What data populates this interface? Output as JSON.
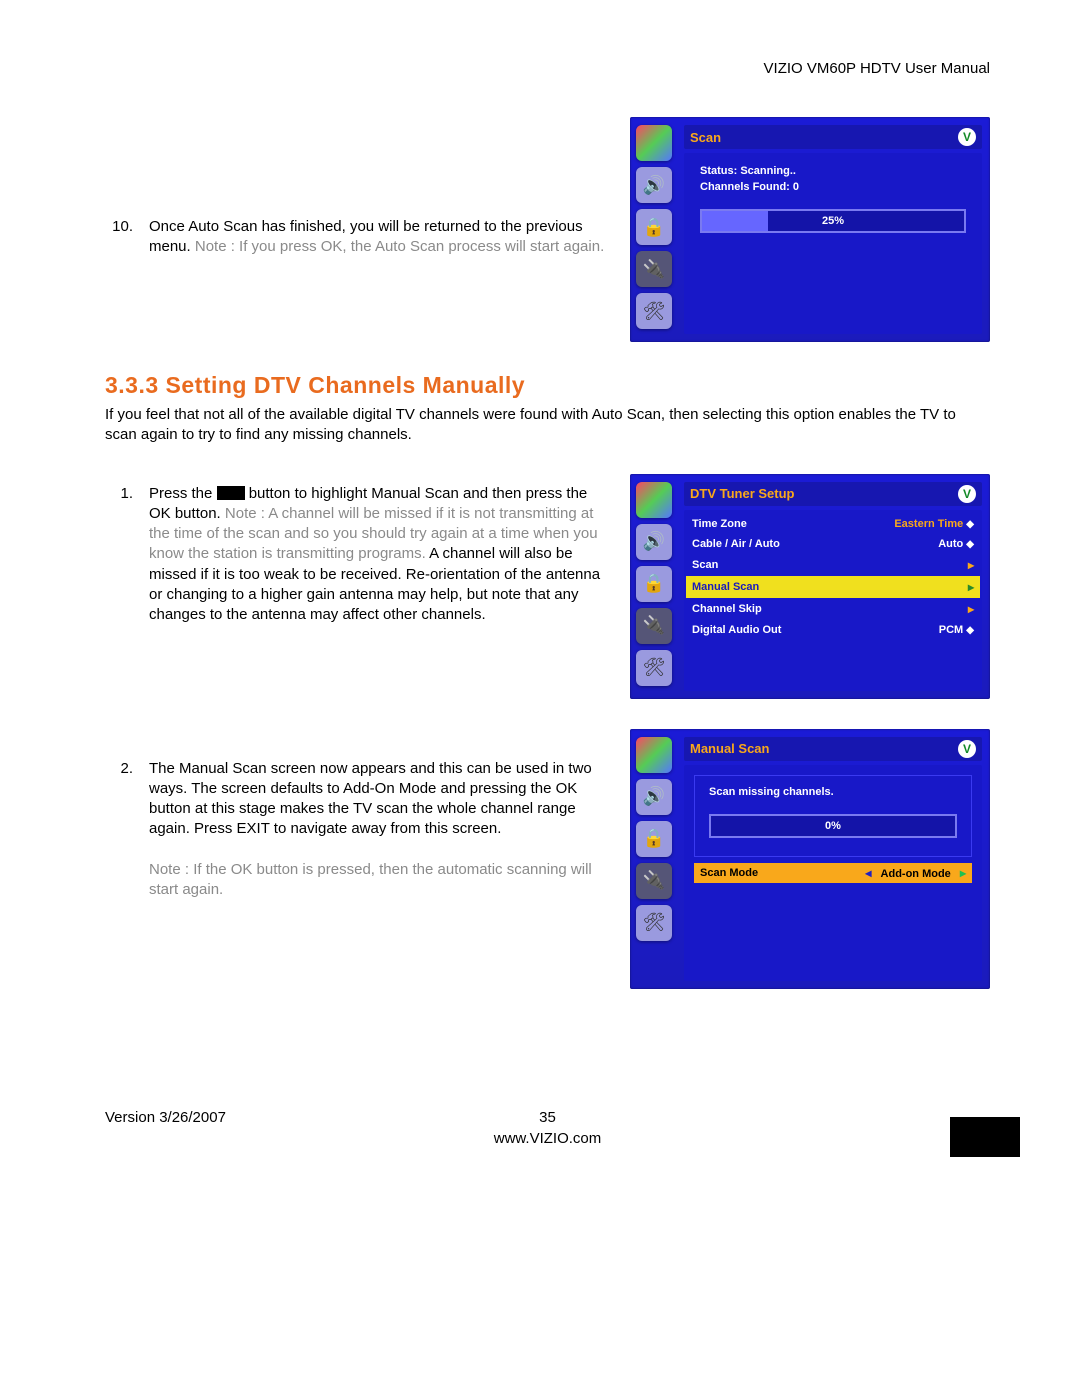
{
  "header": "VIZIO VM60P HDTV User Manual",
  "step10": {
    "num": "10.",
    "text_a": "Once Auto Scan has finished, you will be returned to the previous menu.  ",
    "note_label": "Note :",
    "note_text": " If you press OK, the Auto Scan process will start again."
  },
  "osd_scan": {
    "title": "Scan",
    "status": "Status: Scanning..",
    "found": "Channels Found: 0",
    "progress_pct": "25%",
    "progress_fill_pct": 25
  },
  "section_heading": "3.3.3 Setting DTV Channels Manually",
  "section_intro": "If you feel that not all of the available digital TV channels were found with Auto Scan, then selecting this option enables the TV to scan again to try to find any missing channels.",
  "step1": {
    "num": "1.",
    "text_a": "Press the ",
    "text_b": " button to highlight Manual Scan and then press the OK button. ",
    "note_label": "Note :",
    "note_text": " A channel will be missed if it is not transmitting at the time of the scan and so you should try again at a time when you know the station is transmitting programs.",
    "text_c": " A channel will also be missed if it is too weak to be received.  Re-orientation of the antenna or changing to a higher gain antenna may help, but note that any changes to the antenna may affect other channels."
  },
  "osd_tuner": {
    "title": "DTV Tuner Setup",
    "rows": [
      {
        "label": "Time Zone",
        "value": "Eastern Time",
        "widget": "updown"
      },
      {
        "label": "Cable / Air / Auto",
        "value": "Auto",
        "widget": "updown"
      },
      {
        "label": "Scan",
        "value": "",
        "widget": "arrow"
      },
      {
        "label": "Manual Scan",
        "value": "",
        "widget": "arrow",
        "highlight": true
      },
      {
        "label": "Channel Skip",
        "value": "",
        "widget": "arrow"
      },
      {
        "label": "Digital Audio Out",
        "value": "PCM",
        "widget": "updown"
      }
    ]
  },
  "step2": {
    "num": "2.",
    "text_a": "The Manual Scan screen now appears and this can be used in two ways.  The screen defaults to Add-On Mode and pressing the OK button at this stage makes the TV scan the whole channel range again.  Press EXIT to navigate away from this screen.",
    "note_label": "Note :",
    "note_text": " If the OK button is pressed, then the automatic scanning will start again."
  },
  "osd_manual": {
    "title": "Manual Scan",
    "msg": "Scan missing channels.",
    "progress_pct": "0%",
    "progress_fill_pct": 0,
    "mode_label": "Scan Mode",
    "mode_value": "Add-on Mode"
  },
  "footer": {
    "version": "Version 3/26/2007",
    "page": "35",
    "site": "www.VIZIO.com"
  }
}
